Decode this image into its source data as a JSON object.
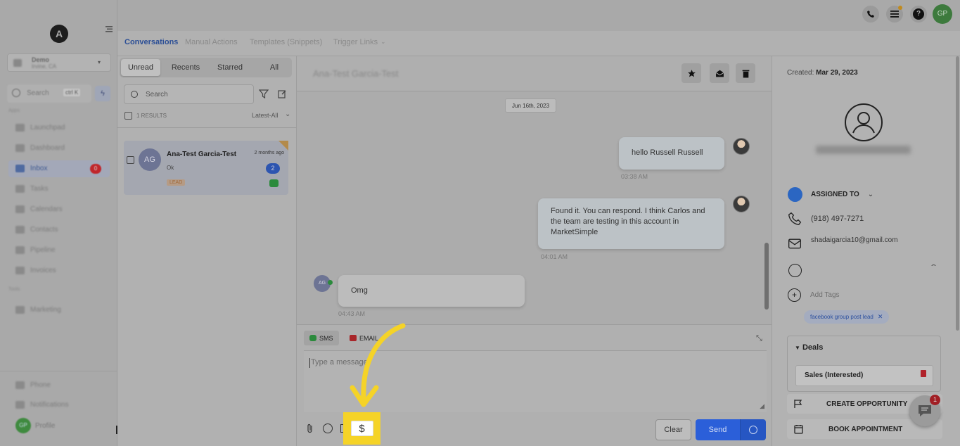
{
  "sidebar": {
    "location_name": "Demo",
    "location_sub": "Irvine, CA",
    "search_label": "Search",
    "search_shortcut": "ctrl K",
    "apps_section": "Apps",
    "items": [
      {
        "label": "Launchpad",
        "icon": "rocket-icon"
      },
      {
        "label": "Dashboard",
        "icon": "dashboard-icon"
      },
      {
        "label": "Inbox",
        "icon": "inbox-icon",
        "badge": "0"
      },
      {
        "label": "Tasks",
        "icon": "tasks-icon"
      },
      {
        "label": "Calendars",
        "icon": "calendar-icon"
      },
      {
        "label": "Contacts",
        "icon": "contacts-icon"
      },
      {
        "label": "Pipeline",
        "icon": "pipeline-icon"
      },
      {
        "label": "Invoices",
        "icon": "invoice-icon"
      }
    ],
    "tools_section": "Tools",
    "tools_items": [
      {
        "label": "Marketing",
        "icon": "megaphone-icon"
      }
    ],
    "footer_items": [
      {
        "label": "Phone",
        "icon": "phone-icon"
      },
      {
        "label": "Notifications",
        "icon": "bell-icon"
      },
      {
        "label": "Profile",
        "icon": "profile-avatar"
      }
    ],
    "profile_initials": "GP"
  },
  "topbar": {
    "user_initials": "GP"
  },
  "tabs": [
    {
      "label": "Conversations",
      "active": true
    },
    {
      "label": "Manual Actions",
      "active": false
    },
    {
      "label": "Templates (Snippets)",
      "active": false
    },
    {
      "label": "Trigger Links",
      "active": false
    }
  ],
  "list": {
    "segments": [
      "Unread",
      "Recents",
      "Starred",
      "All"
    ],
    "active_segment": "Unread",
    "search_placeholder": "Search",
    "results": "1 RESULTS",
    "sort": "Latest-All",
    "conversation": {
      "initials": "AG",
      "name": "Ana-Test Garcia-Test",
      "time": "2 months ago",
      "preview": "Ok",
      "count": "2",
      "tag": "LEAD"
    }
  },
  "conversation": {
    "header_name": "Ana-Test Garcia-Test",
    "date_chip": "Jun 16th, 2023",
    "messages": [
      {
        "text": "hello Russell Russell",
        "time": "03:38 AM",
        "dir": "out"
      },
      {
        "text": "Found it. You can respond. I think Carlos and the team are testing in this account in MarketSimple",
        "time": "04:01 AM",
        "dir": "out"
      },
      {
        "text": "Omg",
        "time": "04:43 AM",
        "dir": "in",
        "initials": "AG"
      }
    ],
    "composer": {
      "channel_sms": "SMS",
      "channel_email": "EMAIL",
      "placeholder": "Type a message",
      "clear_label": "Clear",
      "send_label": "Send",
      "dollar_glyph": "$"
    }
  },
  "contact": {
    "created_label": "Created:",
    "created_date": "Mar 29, 2023",
    "assigned_label": "ASSIGNED TO",
    "phone": "(918) 497-7271",
    "email": "shadaigarcia10@gmail.com",
    "add_tags": "Add Tags",
    "tag": "facebook group post lead",
    "deals_title": "Deals",
    "deal_name": "Sales (Interested)",
    "create_opportunity": "CREATE OPPORTUNITY",
    "book_appointment": "BOOK APPOINTMENT",
    "chat_badge": "1"
  },
  "colors": {
    "accent": "#2b5fd9",
    "highlight": "#f5d327",
    "arrow": "#f5d327",
    "badge_red": "#c0262b"
  }
}
